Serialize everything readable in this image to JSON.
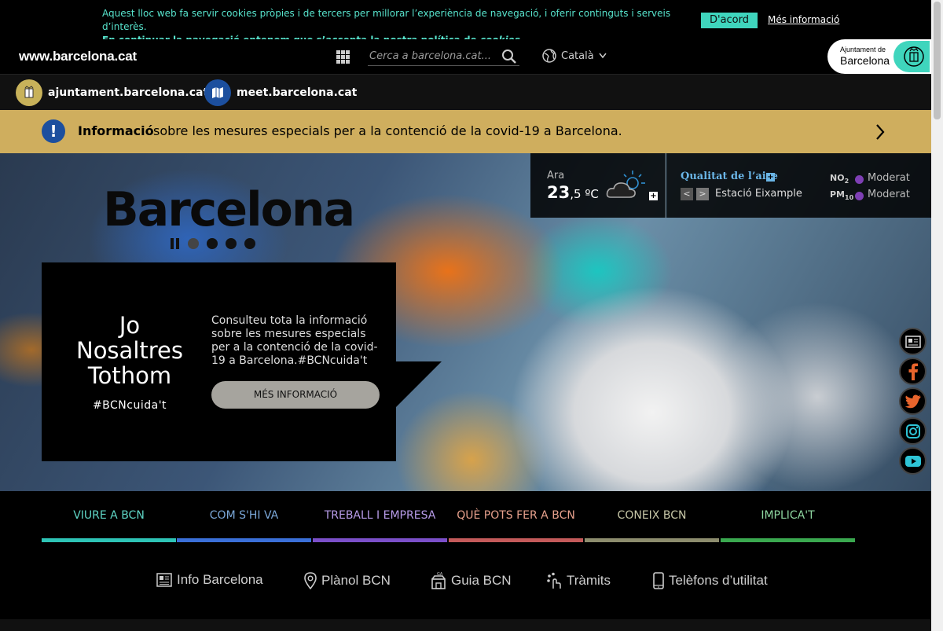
{
  "cookie": {
    "line1": "Aquest lloc web fa servir cookies pròpies i de tercers per millorar l’experiència de navegació, i oferir continguts i serveis d’interès.",
    "line2_text": "En continuar la navegació entenem que s’accepta la nostra política de ",
    "line2_link": "cookies",
    "line2_end": ".",
    "accept_label": "D'acord",
    "more_label": "Més informació"
  },
  "header": {
    "site_title": "www.barcelona.cat",
    "search_placeholder": "Cerca a barcelona.cat...",
    "language": "Català",
    "logo_small": "Ajuntament de",
    "logo_big": "Barcelona"
  },
  "portals": [
    {
      "label": "ajuntament.barcelona.cat",
      "color": "#c8b25a"
    },
    {
      "label": "meet.barcelona.cat",
      "color": "#1c4f9e"
    }
  ],
  "info_banner": {
    "icon": "!",
    "label": "Informació",
    "text": "sobre les mesures especials per a la contenció de la covid-19 a Barcelona."
  },
  "hero": {
    "title": "Barcelona",
    "promo": {
      "heading_l1": "Jo",
      "heading_l2": "Nosaltres",
      "heading_l3": "Tothom",
      "tag": "#BCNcuida't",
      "text": "Consulteu tota la informació sobre les mesures especials per a la contenció de la covid-19 a Barcelona.#BCNcuida't",
      "button": "MÉS INFORMACIÓ"
    }
  },
  "weather": {
    "label": "Ara",
    "temp_int": "23",
    "temp_dec": ",5",
    "unit": " ºC",
    "plus": "+"
  },
  "air_quality": {
    "title": "Qualitat de l’aire",
    "plus": "+",
    "prev": "<",
    "next": ">",
    "station": "Estació Eixample",
    "items": [
      {
        "name": "NO",
        "sub": "2",
        "status": "Moderat"
      },
      {
        "name": "PM",
        "sub": "10",
        "status": "Moderat"
      }
    ],
    "status_color": "#7e3fb4"
  },
  "main_nav": [
    {
      "label": "VIURE A BCN",
      "color": "#2ec4b6"
    },
    {
      "label": "COM S'HI VA",
      "color": "#3a6fd8"
    },
    {
      "label": "TREBALL I EMPRESA",
      "color": "#7b4fc9"
    },
    {
      "label": "QUÈ POTS FER A BCN",
      "color": "#c45a5a"
    },
    {
      "label": "CONEIX BCN",
      "color": "#8d8d6e"
    },
    {
      "label": "IMPLICA'T",
      "color": "#3aa84f"
    }
  ],
  "utility_links": [
    {
      "label": "Info Barcelona"
    },
    {
      "label": "Plànol BCN"
    },
    {
      "label": "Guia BCN"
    },
    {
      "label": "Tràmits"
    },
    {
      "label": "Telèfons d’utilitat"
    }
  ],
  "colors": {
    "accent": "#3fd5bd",
    "banner": "#cfae5e"
  }
}
